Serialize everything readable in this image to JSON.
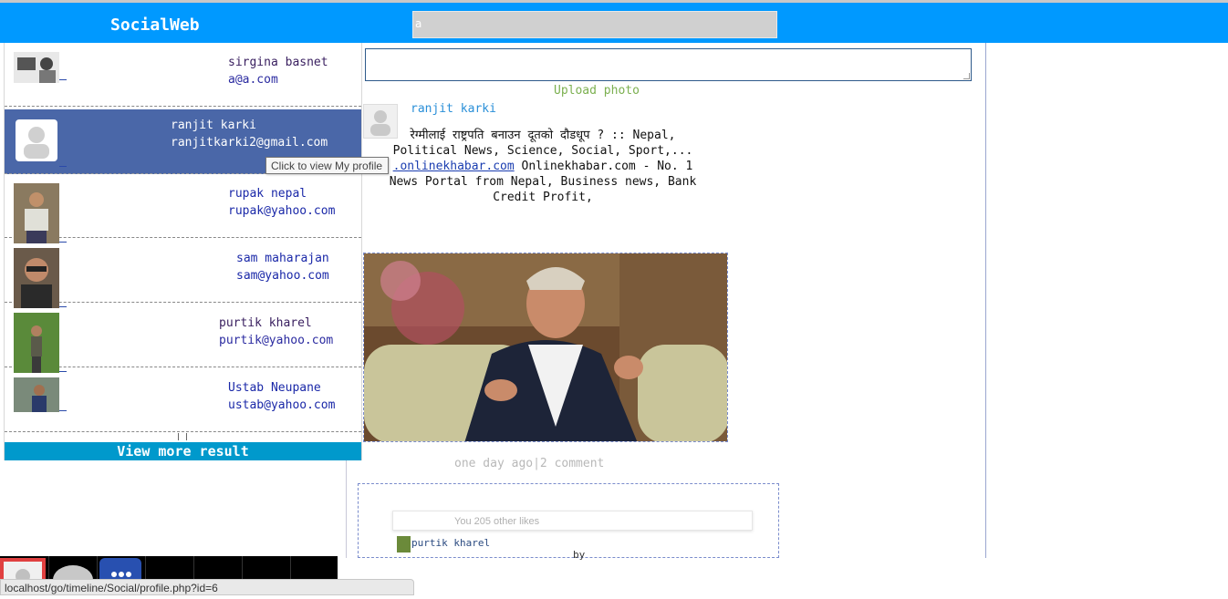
{
  "header": {
    "brand": "SocialWeb",
    "search_value": "a"
  },
  "post_form": {
    "upload_label": "Upload photo"
  },
  "post": {
    "author": "ranjit karki",
    "text_line1": "रेग्मीलाई राष्ट्रपति बनाउन दूतको दौडधूप ? :: Nepal,",
    "text_line2": "Political News, Science, Social, Sport,...",
    "link": ".onlinekhabar.com",
    "text_line3_rest": " Onlinekhabar.com - No. 1",
    "text_line4": "News Portal from Nepal, Business news, Bank",
    "text_line5": "Credit Profit,",
    "meta": "one day ago|2 comment",
    "likes": "You 205 other likes",
    "liker": "purtik kharel",
    "by": "by"
  },
  "search_results": {
    "items": [
      {
        "name": "sirgina basnet",
        "email": "a@a.com"
      },
      {
        "name": "ranjit karki",
        "email": "ranjitkarki2@gmail.com"
      },
      {
        "name": "rupak nepal",
        "email": "rupak@yahoo.com"
      },
      {
        "name": "sam maharajan",
        "email": "sam@yahoo.com"
      },
      {
        "name": "purtik kharel",
        "email": "purtik@yahoo.com"
      },
      {
        "name": "Ustab Neupane",
        "email": "ustab@yahoo.com"
      }
    ],
    "view_more": "View more result",
    "tooltip": "Click to view My profile"
  },
  "status_bar": {
    "url": "localhost/go/timeline/Social/profile.php?id=6"
  }
}
